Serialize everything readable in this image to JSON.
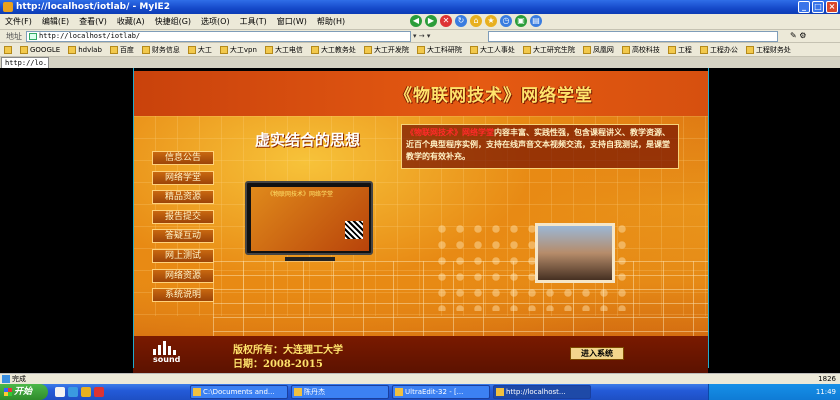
{
  "window": {
    "title": "http://localhost/iotlab/ - MyIE2",
    "buttons": [
      "_",
      "□",
      "×"
    ]
  },
  "menu": {
    "items": [
      "文件(F)",
      "编辑(E)",
      "查看(V)",
      "收藏(A)",
      "快捷组(G)",
      "选项(O)",
      "工具(T)",
      "窗口(W)",
      "帮助(H)"
    ]
  },
  "address": {
    "label": "地址",
    "url": "http://localhost/iotlab/",
    "arrows": "▾ → ▾"
  },
  "favorites": {
    "items": [
      "GOOGLE",
      "hdvlab",
      "百度",
      "财务信息",
      "大工",
      "大工vpn",
      "大工电信",
      "大工教务处",
      "大工开发院",
      "大工科研院",
      "大工人事处",
      "大工研究生院",
      "凤凰网",
      "高校科技",
      "工程",
      "工程办公",
      "工程财务处"
    ]
  },
  "tab": {
    "label": "http://lo..."
  },
  "page": {
    "banner_title": "《物联网技术》网络学堂",
    "slogan": "虚实结合的思想",
    "description_highlight": "《物联网技术》网络学堂",
    "description": "内容丰富、实践性强，包含课程讲义、教学资源、近百个典型程序实例，支持在线声音文本视频交流，支持自我测试，是课堂教学的有效补充。",
    "nav": [
      "信息公告",
      "网络学堂",
      "精品资源",
      "报告提交",
      "答疑互动",
      "网上测试",
      "网络资源",
      "系统说明"
    ],
    "monitor_title": "《物联网技术》网络学堂",
    "logo_word": "sound",
    "copyright": "版权所有：大连理工大学",
    "dates": "日期：2008-2015",
    "enter_button": "进入系统"
  },
  "status": {
    "text": "完成",
    "right": "1826"
  },
  "taskbar": {
    "start": "开始",
    "items": [
      "C:\\Documents and...",
      "陈丹杰",
      "UltraEdit-32 - [...",
      "http://localhost..."
    ],
    "clock": "11:49"
  }
}
